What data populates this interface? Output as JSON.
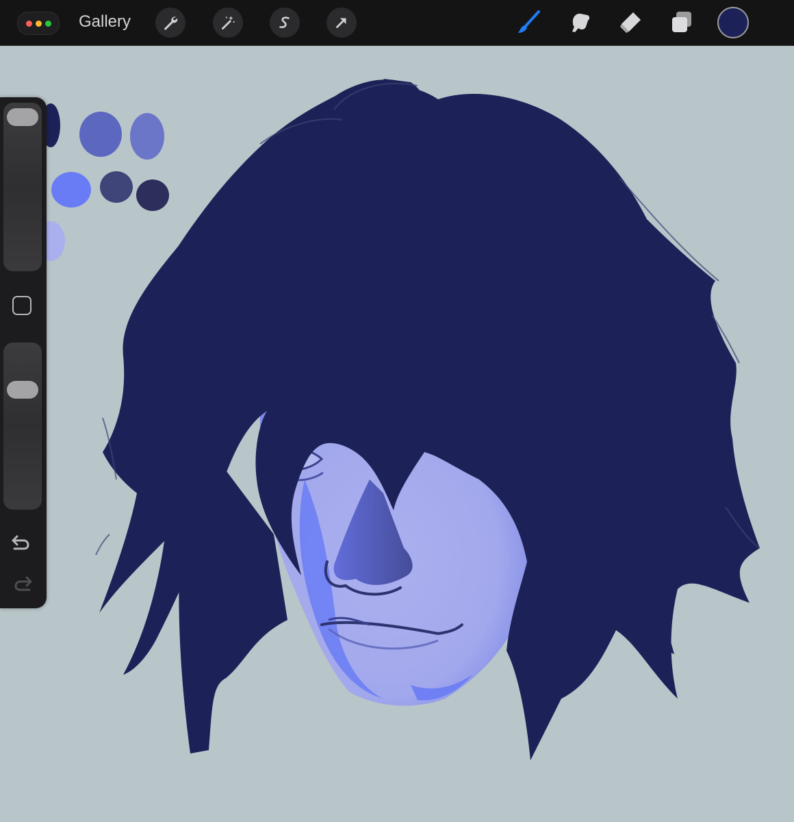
{
  "topbar": {
    "gallery_label": "Gallery",
    "window_dots": [
      "#ff5f57",
      "#febc2e",
      "#28c840"
    ],
    "left_tools": [
      "wrench-icon",
      "magic-wand-icon",
      "selection-icon",
      "transform-arrow-icon"
    ],
    "right_tools": [
      "brush-icon",
      "smudge-icon",
      "eraser-icon",
      "layers-icon"
    ],
    "active_tool": "brush-icon",
    "active_tool_color": "#1f7cf3",
    "current_color": "#1c2257"
  },
  "sidebar": {
    "brush_size_level": 0.0,
    "brush_opacity_level": 0.28,
    "icons": [
      "modify-square-icon",
      "undo-icon",
      "redo-icon"
    ]
  },
  "canvas": {
    "background": "#b8c5c9",
    "palette_swatches": [
      "#1c2257",
      "#5c67c0",
      "#6b76c9",
      "#6a7cf5",
      "#3f4479",
      "#2c2f5b",
      "#aab0ee"
    ],
    "hair_color": "#1c2257",
    "skin_color": "#aab0ee",
    "highlight_color": "#6a7cf5"
  }
}
